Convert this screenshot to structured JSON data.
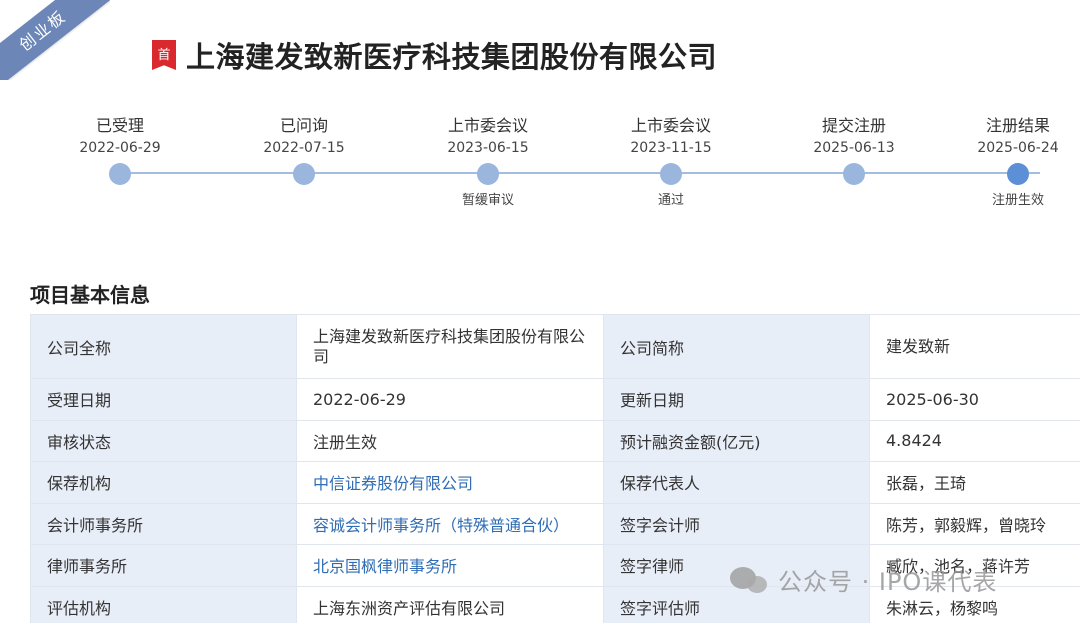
{
  "board": {
    "ribbon_label": "创业板",
    "badge_label": "首"
  },
  "company": {
    "title": "上海建发致新医疗科技集团股份有限公司"
  },
  "timeline": {
    "steps": [
      {
        "label": "已受理",
        "date": "2022-06-29",
        "result": ""
      },
      {
        "label": "已问询",
        "date": "2022-07-15",
        "result": ""
      },
      {
        "label": "上市委会议",
        "date": "2023-06-15",
        "result": "暂缓审议"
      },
      {
        "label": "上市委会议",
        "date": "2023-11-15",
        "result": "通过"
      },
      {
        "label": "提交注册",
        "date": "2025-06-13",
        "result": ""
      },
      {
        "label": "注册结果",
        "date": "2025-06-24",
        "result": "注册生效"
      }
    ],
    "colors": {
      "line": "#a3bde0",
      "dot": "#9bb6dc",
      "active_dot": "#5d8fd6"
    }
  },
  "section": {
    "title": "项目基本信息"
  },
  "info": {
    "rows": [
      {
        "k1": "公司全称",
        "v1": "上海建发致新医疗科技集团股份有限公司",
        "k2": "公司简称",
        "v2": "建发致新"
      },
      {
        "k1": "受理日期",
        "v1": "2022-06-29",
        "k2": "更新日期",
        "v2": "2025-06-30"
      },
      {
        "k1": "审核状态",
        "v1": "注册生效",
        "k2": "预计融资金额(亿元)",
        "v2": "4.8424"
      },
      {
        "k1": "保荐机构",
        "v1": "中信证券股份有限公司",
        "k2": "保荐代表人",
        "v2": "张磊，王琦"
      },
      {
        "k1": "会计师事务所",
        "v1": "容诚会计师事务所（特殊普通合伙）",
        "k2": "签字会计师",
        "v2": "陈芳，郭毅辉，曾晓玲"
      },
      {
        "k1": "律师事务所",
        "v1": "北京国枫律师事务所",
        "k2": "签字律师",
        "v2": "臧欣，池名，蒋许芳"
      },
      {
        "k1": "评估机构",
        "v1": "上海东洲资产评估有限公司",
        "k2": "签字评估师",
        "v2": "朱淋云，杨黎鸣"
      }
    ],
    "colors": {
      "key_bg": "#e8eef8",
      "link": "#2f6db5",
      "border": "#e1e6ee"
    }
  },
  "watermark": {
    "text": "公众号 · IPO课代表",
    "icon": "wechat-icon"
  }
}
